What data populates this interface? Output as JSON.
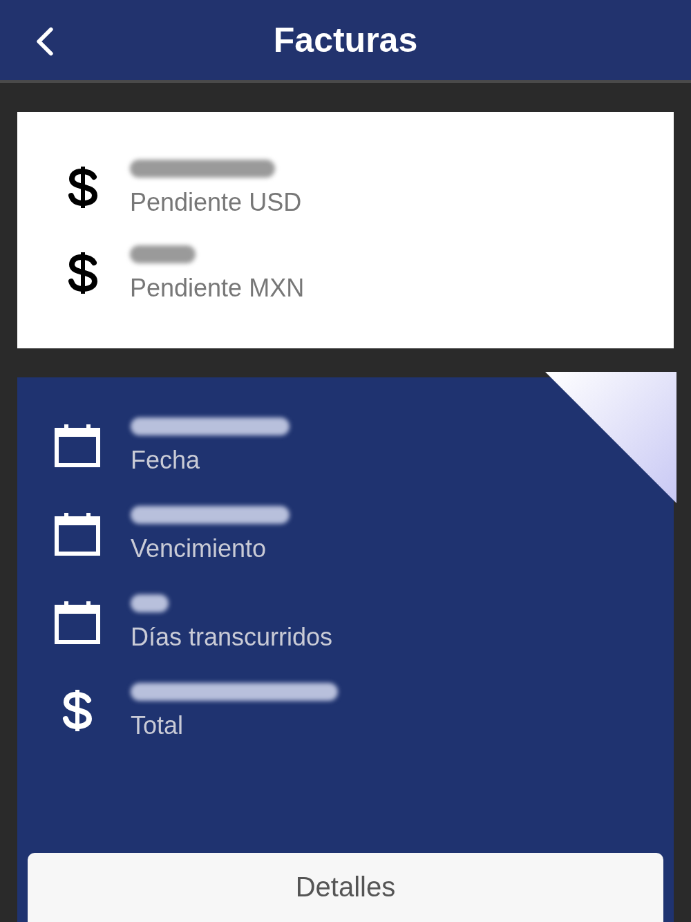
{
  "header": {
    "title": "Facturas"
  },
  "summary": [
    {
      "kind": "dollar",
      "label": "Pendiente USD"
    },
    {
      "kind": "dollar",
      "label": "Pendiente MXN"
    }
  ],
  "invoice": {
    "fields": [
      {
        "kind": "calendar",
        "label": "Fecha"
      },
      {
        "kind": "calendar",
        "label": "Vencimiento"
      },
      {
        "kind": "calendar",
        "label": "Días transcurridos"
      },
      {
        "kind": "dollar",
        "label": "Total"
      }
    ],
    "button": "Detalles"
  }
}
